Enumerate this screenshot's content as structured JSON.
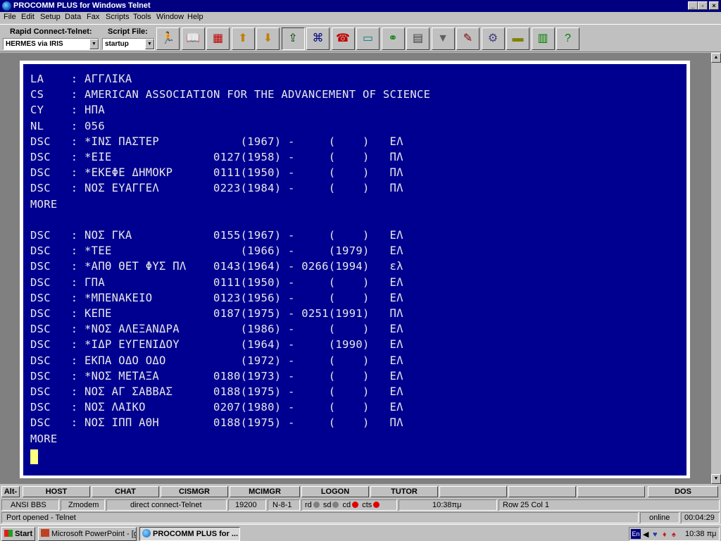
{
  "window": {
    "title": "PROCOMM PLUS for Windows Telnet",
    "controls": {
      "minimize": "_",
      "restore": "▫",
      "close": "×"
    }
  },
  "menu": [
    "File",
    "Edit",
    "Setup",
    "Data",
    "Fax",
    "Scripts",
    "Tools",
    "Window",
    "Help"
  ],
  "toolbar": {
    "connect_label": "Rapid Connect-Telnet:",
    "connect_value": "HERMES via IRIS",
    "script_label": "Script File:",
    "script_value": "startup",
    "buttons": [
      "run-icon",
      "phonebook-icon",
      "mode-icon",
      "send-file-icon",
      "receive-file-icon",
      "upload-icon",
      "meta-keys-icon",
      "dial-icon",
      "terminal-icon",
      "attach-icon",
      "printer-icon",
      "capture-icon",
      "notes-icon",
      "setup-icon",
      "keyboard-icon",
      "toggle-icon",
      "help-icon"
    ]
  },
  "terminal": {
    "lines": [
      "LA    : ΑΓΓΛΙΚΑ",
      "CS    : AMERICAN ASSOCIATION FOR THE ADVANCEMENT OF SCIENCE",
      "CY    : ΗΠΑ",
      "NL    : 056",
      "DSC   : *ΙΝΣ ΠΑΣΤΕΡ            (1967) -     (    )   ΕΛ",
      "DSC   : *ΕΙΕ               0127(1958) -     (    )   ΠΛ",
      "DSC   : *ΕΚΕΦΕ ΔΗΜΟΚΡ      0111(1950) -     (    )   ΠΛ",
      "DSC   : ΝΟΣ ΕΥΑΓΓΕΛ        0223(1984) -     (    )   ΠΛ",
      "MORE",
      "",
      "DSC   : ΝΟΣ ΓΚΑ            0155(1967) -     (    )   ΕΛ",
      "DSC   : *ΤΕΕ                   (1966) -     (1979)   ΕΛ",
      "DSC   : *ΑΠΘ ΘΕΤ ΦΥΣ ΠΛ    0143(1964) - 0266(1994)   ελ",
      "DSC   : ΓΠΑ                0111(1950) -     (    )   ΕΛ",
      "DSC   : *ΜΠΕΝΑΚΕΙΟ         0123(1956) -     (    )   ΕΛ",
      "DSC   : ΚΕΠΕ               0187(1975) - 0251(1991)   ΠΛ",
      "DSC   : *ΝΟΣ ΑΛΕΞΑΝΔΡΑ         (1986) -     (    )   ΕΛ",
      "DSC   : *ΙΔΡ ΕΥΓΕΝΙΔΟΥ         (1964) -     (1990)   ΕΛ",
      "DSC   : ΕΚΠΑ ΟΔΟ ΟΔΟ           (1972) -     (    )   ΕΛ",
      "DSC   : *ΝΟΣ ΜΕΤΑΞΑ        0180(1973) -     (    )   ΕΛ",
      "DSC   : ΝΟΣ ΑΓ ΣΑΒΒΑΣ      0188(1975) -     (    )   ΕΛ",
      "DSC   : ΝΟΣ ΛΑΙΚΟ          0207(1980) -     (    )   ΕΛ",
      "DSC   : ΝΟΣ ΙΠΠ ΑΘΗ        0188(1975) -     (    )   ΠΛ",
      "MORE"
    ]
  },
  "fkeys": [
    "Alt-",
    "HOST",
    "CHAT",
    "CISMGR",
    "MCIMGR",
    "LOGON",
    "TUTOR",
    "",
    "",
    "",
    "DOS"
  ],
  "status": {
    "emulation": "ANSI BBS",
    "protocol": "Zmodem",
    "connection": "direct connect-Telnet",
    "baud": "19200",
    "parity": "N-8-1",
    "led_labels": [
      "rd",
      "sd",
      "cd",
      "cts"
    ],
    "time": "10:38πμ",
    "position": "Row 25   Col 1",
    "message": "Port opened - Telnet",
    "state": "online",
    "elapsed": "00:04:29"
  },
  "colors": {
    "terminal_bg": "#000090",
    "led_off": "#808080",
    "led_on": "#e00000"
  },
  "taskbar": {
    "start": "Start",
    "apps": [
      "Microsoft PowerPoint - [gri...",
      "PROCOMM PLUS for ..."
    ],
    "tray_lang": "En",
    "tray_time": "10:38 πμ"
  }
}
